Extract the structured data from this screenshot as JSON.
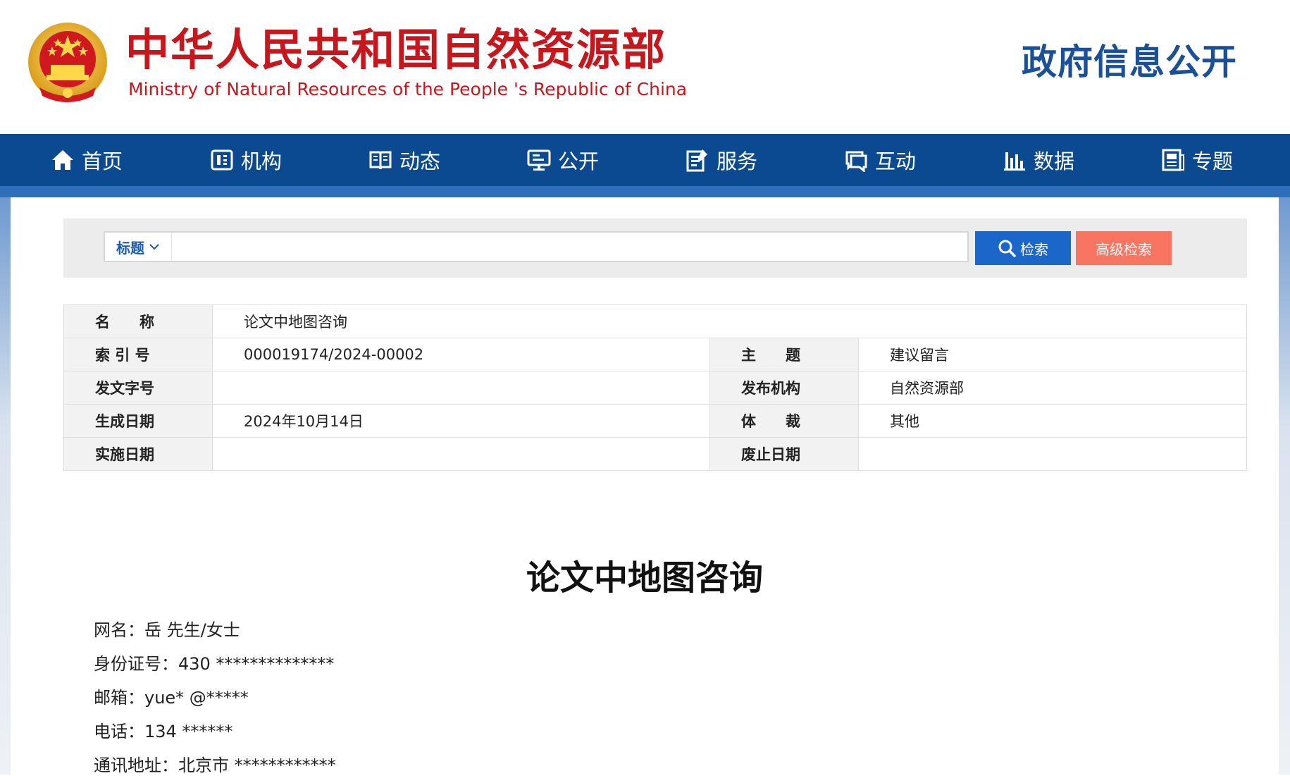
{
  "header": {
    "title_cn": "中华人民共和国自然资源部",
    "title_en": "Ministry of Natural Resources of the People 's Republic of China",
    "section": "政府信息公开"
  },
  "nav": [
    {
      "label": "首页",
      "icon": "home-icon"
    },
    {
      "label": "机构",
      "icon": "organization-icon"
    },
    {
      "label": "动态",
      "icon": "book-icon"
    },
    {
      "label": "公开",
      "icon": "monitor-icon"
    },
    {
      "label": "服务",
      "icon": "document-edit-icon"
    },
    {
      "label": "互动",
      "icon": "chat-icon"
    },
    {
      "label": "数据",
      "icon": "bar-chart-icon"
    },
    {
      "label": "专题",
      "icon": "newspaper-icon"
    }
  ],
  "search": {
    "type_label": "标题",
    "placeholder": "",
    "search_label": "检索",
    "advanced_label": "高级检索"
  },
  "meta": {
    "name_label": "名　　称",
    "name_value": "论文中地图咨询",
    "index_label": "索 引 号",
    "index_value": "000019174/2024-00002",
    "topic_label": "主　　题",
    "topic_value": "建议留言",
    "doc_no_label": "发文字号",
    "doc_no_value": "",
    "publisher_label": "发布机构",
    "publisher_value": "自然资源部",
    "date_label": "生成日期",
    "date_value": "2024年10月14日",
    "genre_label": "体　　裁",
    "genre_value": "其他",
    "effective_label": "实施日期",
    "effective_value": "",
    "expire_label": "废止日期",
    "expire_value": ""
  },
  "article": {
    "title": "论文中地图咨询",
    "lines": [
      "网名：岳 先生/女士",
      "身份证号：430 **************",
      "邮箱：yue* @*****",
      "电话：134 ******",
      "通讯地址：北京市 ************"
    ]
  },
  "colors": {
    "brand_red": "#c8161d",
    "nav_blue": "#0b4a91",
    "search_blue": "#1b66c9",
    "advanced_salmon": "#f87562"
  }
}
